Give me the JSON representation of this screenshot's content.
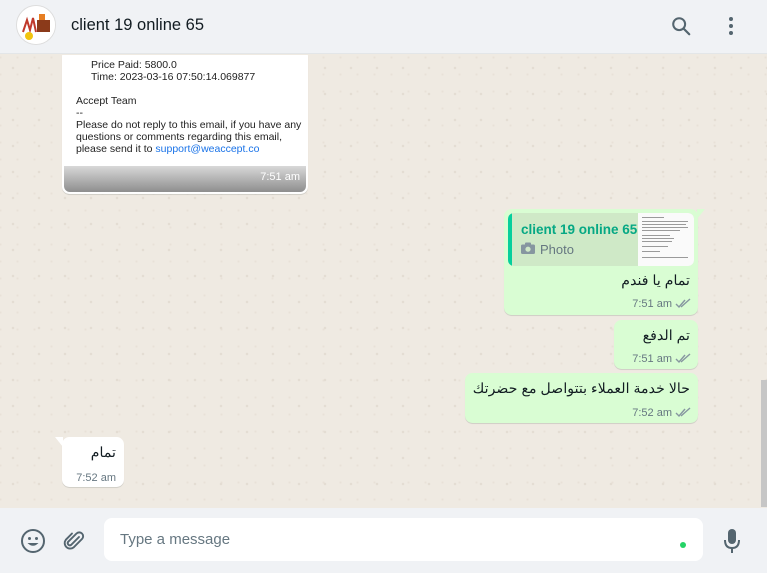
{
  "header": {
    "contact_name": "client 19 online 65",
    "avatar_icon": "contact-avatar",
    "search_icon": "search-icon",
    "menu_icon": "kebab-menu-icon"
  },
  "messages": [
    {
      "direction": "incoming",
      "type": "email-image",
      "lines": {
        "price": "Price Paid: 5800.0",
        "time": "Time: 2023-03-16 07:50:14.069877",
        "team": "Accept Team",
        "dash": "--",
        "body1": "Please do not reply to this email, if you have any",
        "body2": "questions or comments regarding this email,",
        "body3": "please send it to ",
        "link": "support@weaccept.co"
      },
      "time": "7:51 am"
    },
    {
      "direction": "outgoing",
      "type": "reply",
      "quote": {
        "name": "client 19 online 65",
        "label": "Photo"
      },
      "text": "تمام يا فندم",
      "time": "7:51 am",
      "status": "read"
    },
    {
      "direction": "outgoing",
      "type": "text",
      "text": "تم الدفع",
      "time": "7:51 am",
      "status": "read"
    },
    {
      "direction": "outgoing",
      "type": "text",
      "text": "حالا خدمة العملاء بتتواصل مع حضرتك",
      "time": "7:52 am",
      "status": "read"
    },
    {
      "direction": "incoming",
      "type": "text",
      "text": "تمام",
      "time": "7:52 am"
    }
  ],
  "composer": {
    "placeholder": "Type a message",
    "emoji_icon": "emoji-icon",
    "attach_icon": "paperclip-icon",
    "mic_icon": "microphone-icon"
  },
  "colors": {
    "header_bg": "#f0f2f5",
    "chat_bg": "#efeae2",
    "outgoing_bubble": "#d9fdd3",
    "incoming_bubble": "#ffffff",
    "accent": "#06cf9c",
    "read_ticks": "#8696a0"
  }
}
